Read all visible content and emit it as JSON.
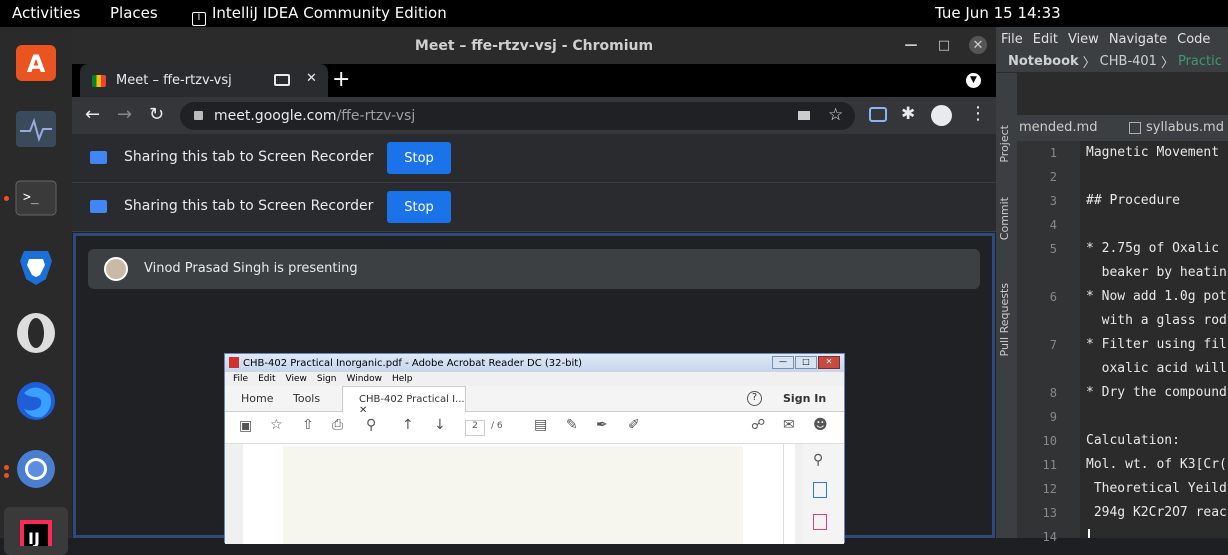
{
  "topbar": {
    "activities": "Activities",
    "places": "Places",
    "app_name": "IntelliJ IDEA Community Edition",
    "clock": "Tue Jun 15  14:33"
  },
  "dock": {
    "items": [
      "ubuntu-software-icon",
      "system-monitor-icon",
      "terminal-icon",
      "brave-icon",
      "opera-icon",
      "firefox-icon",
      "chromium-icon",
      "intellij-icon"
    ]
  },
  "chromium": {
    "window_title": "Meet – ffe-rtzv-vsj - Chromium",
    "tab_title": "Meet – ffe-rtzv-vsj",
    "url_domain": "meet.google.com",
    "url_path": "/ffe-rtzv-vsj",
    "infobars": [
      {
        "text": "Sharing this tab to Screen Recorder",
        "button": "Stop"
      },
      {
        "text": "Sharing this tab to Screen Recorder",
        "button": "Stop"
      }
    ]
  },
  "meet": {
    "presenter_text": "Vinod Prasad Singh is presenting"
  },
  "acrobat": {
    "title": "CHB-402 Practical Inorganic.pdf - Adobe Acrobat Reader DC (32-bit)",
    "menu": [
      "File",
      "Edit",
      "View",
      "Sign",
      "Window",
      "Help"
    ],
    "tabs": {
      "home": "Home",
      "tools": "Tools",
      "doc": "CHB-402 Practical I..."
    },
    "sign_in": "Sign In",
    "page_current": "2",
    "page_total": "/ 6"
  },
  "ide": {
    "menu": [
      "File",
      "Edit",
      "View",
      "Navigate",
      "Code"
    ],
    "breadcrumb": [
      "Notebook",
      "CHB-401",
      "Practic"
    ],
    "side_tabs": [
      "Project",
      "Commit",
      "Pull Requests"
    ],
    "file_tabs": [
      "mended.md",
      "syllabus.md"
    ],
    "line_numbers": [
      "1",
      "2",
      "3",
      "4",
      "5",
      "",
      "6",
      "",
      "7",
      "",
      "8",
      "9",
      "10",
      "11",
      "12",
      "13",
      "14"
    ],
    "code_lines": [
      "Magnetic Movement",
      "",
      "## Procedure",
      "",
      "* 2.75g of Oxalic",
      "  beaker by heatin",
      "* Now add 1.0g pot",
      "  with a glass rod",
      "* Filter using fil",
      "  oxalic acid will",
      "* Dry the compound",
      "",
      "Calculation:",
      "Mol. wt. of K3[Cr(",
      " Theoretical Yeild",
      " 294g K2Cr2O7 reac",
      ""
    ]
  }
}
